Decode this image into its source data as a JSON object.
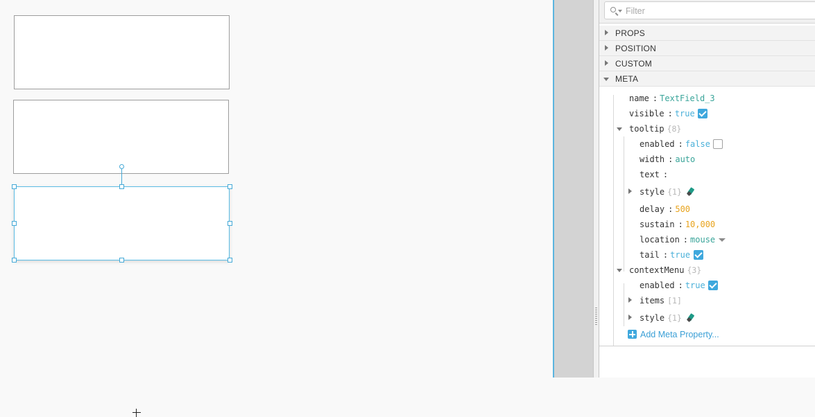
{
  "filter": {
    "placeholder": "Filter"
  },
  "sections": {
    "props": "PROPS",
    "position": "POSITION",
    "custom": "CUSTOM",
    "meta": "META"
  },
  "meta": {
    "name": {
      "key": "name",
      "value": "TextField_3"
    },
    "visible": {
      "key": "visible",
      "value": "true",
      "checked": true
    },
    "tooltip": {
      "key": "tooltip",
      "count": "{8}",
      "expanded": true,
      "enabled": {
        "key": "enabled",
        "value": "false",
        "checked": false
      },
      "width": {
        "key": "width",
        "value": "auto"
      },
      "text": {
        "key": "text",
        "value": ""
      },
      "style": {
        "key": "style",
        "count": "{1}",
        "icon": "style-brush-icon"
      },
      "delay": {
        "key": "delay",
        "value": "500"
      },
      "sustain": {
        "key": "sustain",
        "value": "10,000"
      },
      "location": {
        "key": "location",
        "value": "mouse"
      },
      "tail": {
        "key": "tail",
        "value": "true",
        "checked": true
      }
    },
    "contextMenu": {
      "key": "contextMenu",
      "count": "{3}",
      "expanded": true,
      "enabled": {
        "key": "enabled",
        "value": "true",
        "checked": true
      },
      "items": {
        "key": "items",
        "count": "[1]"
      },
      "style": {
        "key": "style",
        "count": "{1}",
        "icon": "style-brush-icon"
      }
    },
    "add_label": "Add Meta Property..."
  },
  "colors": {
    "accent": "#3fa8dd",
    "string_value": "#3aa59a",
    "boolean_value": "#4ab0d9",
    "number_value": "#e8a31c",
    "selection": "#5bbce4"
  }
}
